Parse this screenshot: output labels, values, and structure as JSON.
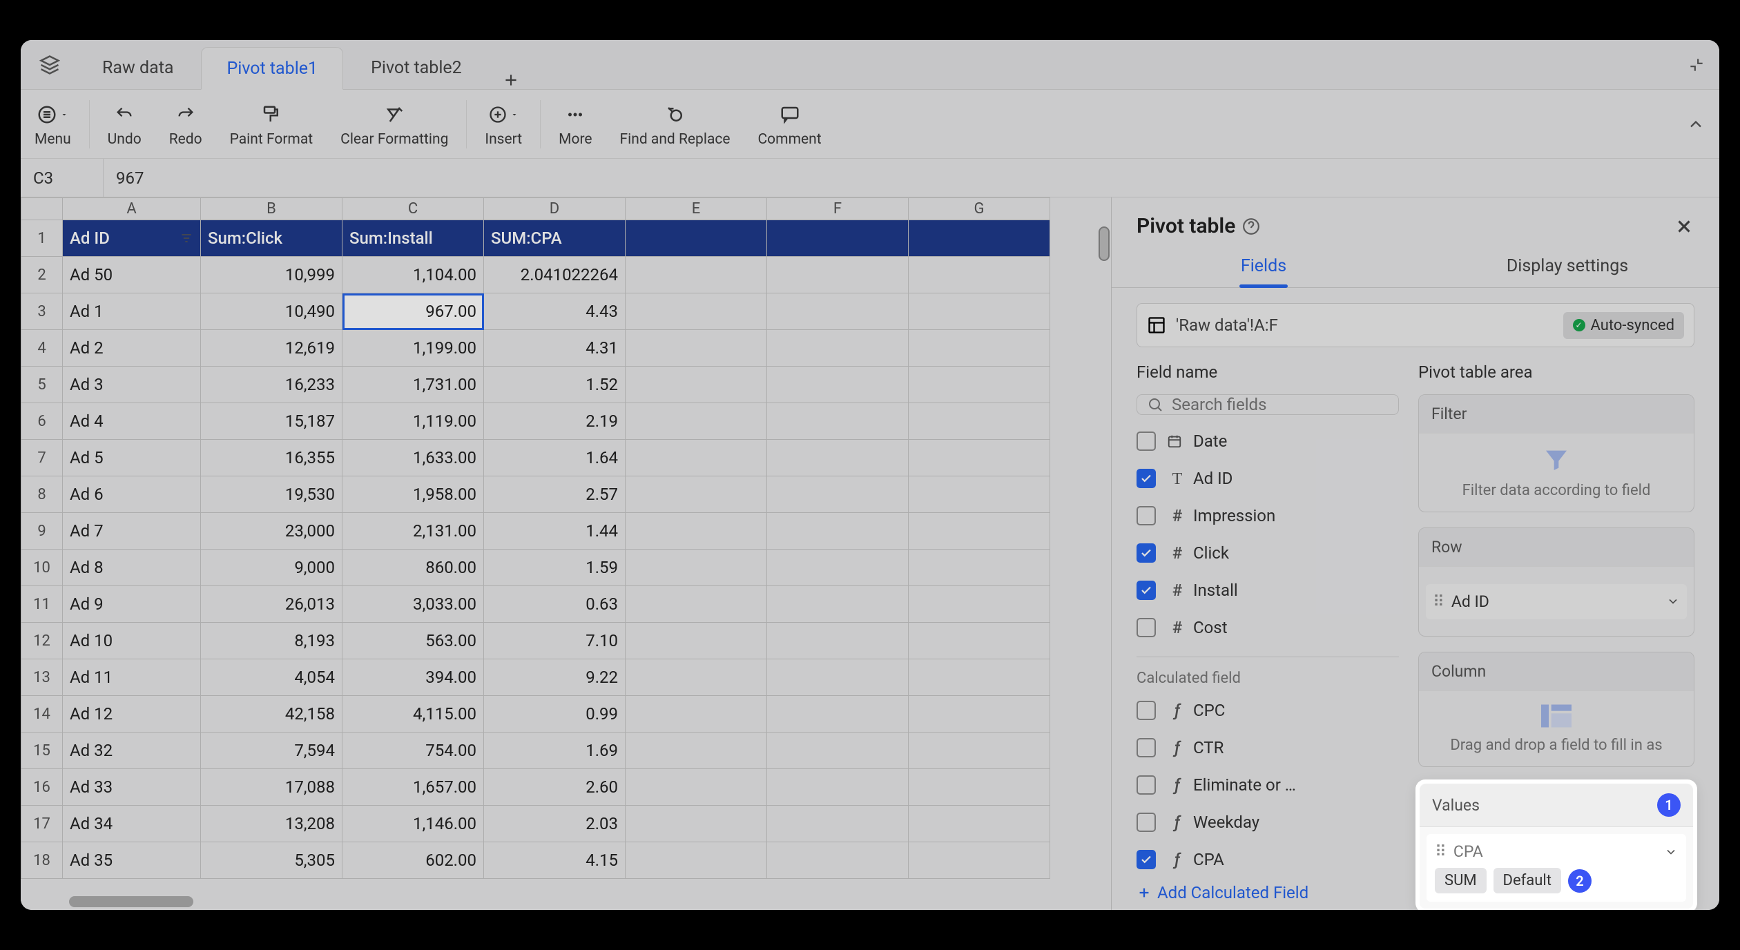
{
  "tabs": {
    "t0": "Raw data",
    "t1": "Pivot table1",
    "t2": "Pivot table2",
    "active": 1
  },
  "toolbar": {
    "menu": "Menu",
    "undo": "Undo",
    "redo": "Redo",
    "paint": "Paint Format",
    "clearf": "Clear Formatting",
    "insert": "Insert",
    "more": "More",
    "find": "Find and Replace",
    "comment": "Comment"
  },
  "cellref": "C3",
  "cellval": "967",
  "columns": [
    "A",
    "B",
    "C",
    "D",
    "E",
    "F",
    "G"
  ],
  "headerRow": [
    "Ad ID",
    "Sum:Click",
    "Sum:Install",
    "SUM:CPA"
  ],
  "rows": [
    {
      "n": 2,
      "c": [
        "Ad 50",
        "10,999",
        "1,104.00",
        "2.041022264"
      ]
    },
    {
      "n": 3,
      "c": [
        "Ad 1",
        "10,490",
        "967.00",
        "4.43"
      ],
      "sel": true
    },
    {
      "n": 4,
      "c": [
        "Ad 2",
        "12,619",
        "1,199.00",
        "4.31"
      ]
    },
    {
      "n": 5,
      "c": [
        "Ad 3",
        "16,233",
        "1,731.00",
        "1.52"
      ]
    },
    {
      "n": 6,
      "c": [
        "Ad 4",
        "15,187",
        "1,119.00",
        "2.19"
      ]
    },
    {
      "n": 7,
      "c": [
        "Ad 5",
        "16,355",
        "1,633.00",
        "1.64"
      ]
    },
    {
      "n": 8,
      "c": [
        "Ad 6",
        "19,530",
        "1,958.00",
        "2.57"
      ]
    },
    {
      "n": 9,
      "c": [
        "Ad 7",
        "23,000",
        "2,131.00",
        "1.44"
      ]
    },
    {
      "n": 10,
      "c": [
        "Ad 8",
        "9,000",
        "860.00",
        "1.59"
      ]
    },
    {
      "n": 11,
      "c": [
        "Ad 9",
        "26,013",
        "3,033.00",
        "0.63"
      ]
    },
    {
      "n": 12,
      "c": [
        "Ad 10",
        "8,193",
        "563.00",
        "7.10"
      ]
    },
    {
      "n": 13,
      "c": [
        "Ad 11",
        "4,054",
        "394.00",
        "9.22"
      ]
    },
    {
      "n": 14,
      "c": [
        "Ad 12",
        "42,158",
        "4,115.00",
        "0.99"
      ]
    },
    {
      "n": 15,
      "c": [
        "Ad 32",
        "7,594",
        "754.00",
        "1.69"
      ]
    },
    {
      "n": 16,
      "c": [
        "Ad 33",
        "17,088",
        "1,657.00",
        "2.60"
      ]
    },
    {
      "n": 17,
      "c": [
        "Ad 34",
        "13,208",
        "1,146.00",
        "2.03"
      ]
    },
    {
      "n": 18,
      "c": [
        "Ad 35",
        "5,305",
        "602.00",
        "4.15"
      ]
    }
  ],
  "panel": {
    "title": "Pivot table",
    "tab_fields": "Fields",
    "tab_display": "Display settings",
    "source": "'Raw data'!A:F",
    "autosync": "Auto-synced",
    "fieldname_label": "Field name",
    "areaname_label": "Pivot table area",
    "search_placeholder": "Search fields",
    "fields": [
      {
        "name": "Date",
        "type": "date",
        "checked": false
      },
      {
        "name": "Ad ID",
        "type": "text",
        "checked": true
      },
      {
        "name": "Impression",
        "type": "num",
        "checked": false
      },
      {
        "name": "Click",
        "type": "num",
        "checked": true
      },
      {
        "name": "Install",
        "type": "num",
        "checked": true
      },
      {
        "name": "Cost",
        "type": "num",
        "checked": false
      }
    ],
    "calc_label": "Calculated field",
    "calcfields": [
      {
        "name": "CPC",
        "checked": false
      },
      {
        "name": "CTR",
        "checked": false
      },
      {
        "name": "Eliminate or …",
        "checked": false
      },
      {
        "name": "Weekday",
        "checked": false
      },
      {
        "name": "CPA",
        "checked": true
      }
    ],
    "addcalc": "Add Calculated Field",
    "areas": {
      "filter": {
        "title": "Filter",
        "hint": "Filter data according to field"
      },
      "row": {
        "title": "Row",
        "items": [
          "Ad ID"
        ]
      },
      "column": {
        "title": "Column",
        "hint": "Drag and drop a field to fill in as"
      },
      "values": {
        "title": "Values",
        "item": "CPA",
        "agg": "SUM",
        "fmt": "Default",
        "badge1": "1",
        "badge2": "2"
      }
    }
  }
}
